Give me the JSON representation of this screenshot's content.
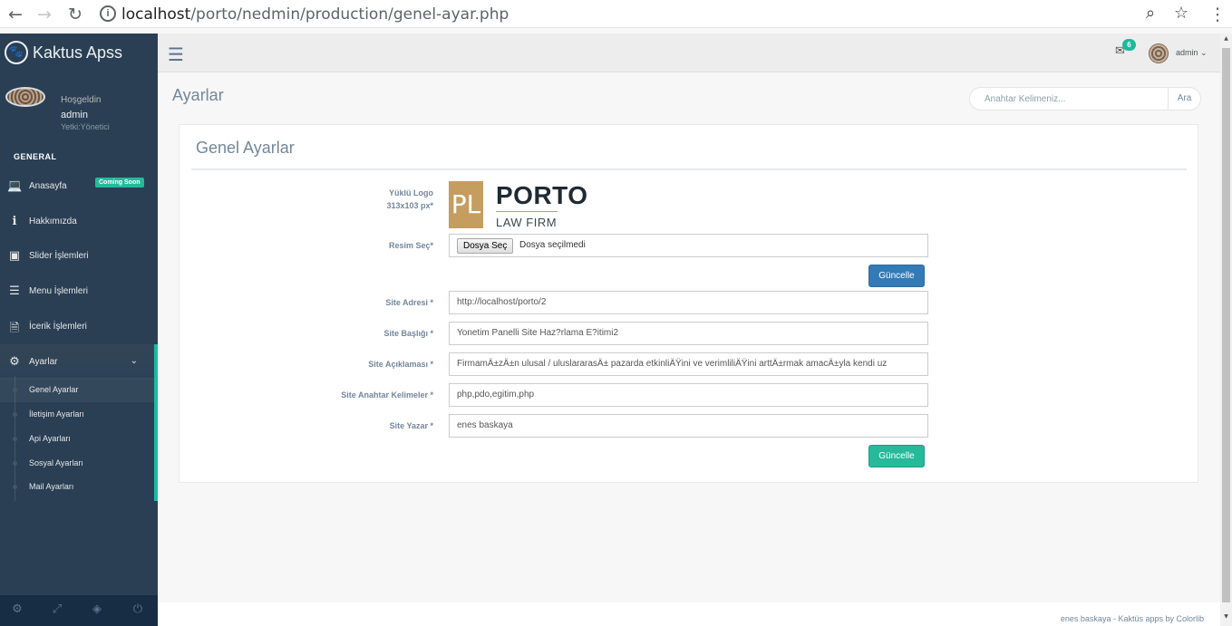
{
  "browser": {
    "url_host": "localhost",
    "url_path": "/porto/nedmin/production/genel-ayar.php"
  },
  "sidebar": {
    "brand": "Kaktus Apss",
    "profile": {
      "welcome": "Hoşgeldin",
      "name": "admin",
      "role": "Yetki:Yönetici"
    },
    "section_title": "GENERAL",
    "items": [
      {
        "label": "Anasayfa",
        "icon": "laptop-icon",
        "badge": "Coming Soon"
      },
      {
        "label": "Hakkımızda",
        "icon": "info-icon"
      },
      {
        "label": "Slider İşlemleri",
        "icon": "image-icon"
      },
      {
        "label": "Menu İşlemleri",
        "icon": "list-icon"
      },
      {
        "label": "İcerik İşlemleri",
        "icon": "document-icon"
      },
      {
        "label": "Ayarlar",
        "icon": "gear-icon"
      }
    ],
    "submenu": [
      {
        "label": "Genel Ayarlar"
      },
      {
        "label": "İletişim Ayarları"
      },
      {
        "label": "Api Ayarları"
      },
      {
        "label": "Sosyal Ayarları"
      },
      {
        "label": "Mail Ayarları"
      }
    ]
  },
  "topnav": {
    "mail_count": "6",
    "user": "admin"
  },
  "page": {
    "title": "Ayarlar",
    "search_placeholder": "Anahtar Kelimeniz...",
    "search_button": "Ara"
  },
  "panel": {
    "title": "Genel Ayarlar",
    "logo_label_line1": "Yüklü Logo",
    "logo_label_line2": "313x103 px*",
    "logo": {
      "mark": "PL",
      "name": "PORTO",
      "sub": "LAW FIRM"
    },
    "file_label": "Resim Seç*",
    "file_button": "Dosya Seç",
    "file_status": "Dosya seçilmedi",
    "update_button_1": "Güncelle",
    "fields": [
      {
        "label": "Site Adresi *",
        "value": "http://localhost/porto/2"
      },
      {
        "label": "Site Başlığı *",
        "value": "Yonetim Panelli Site Haz?rlama E?itimi2"
      },
      {
        "label": "Site Açıklaması *",
        "value": "FirmamÄ±zÄ±n ulusal / uluslararasÄ± pazarda etkinliÄŸini ve verimliliÄŸini arttÄ±rmak amacÄ±yla kendi uz"
      },
      {
        "label": "Site Anahtar Kelimeler *",
        "value": "php,pdo,egitim,php"
      },
      {
        "label": "Site Yazar *",
        "value": "enes baskaya"
      }
    ],
    "update_button_2": "Güncelle"
  },
  "footer": {
    "text": "enes baskaya - Kaktüs apps by Colorlib"
  }
}
